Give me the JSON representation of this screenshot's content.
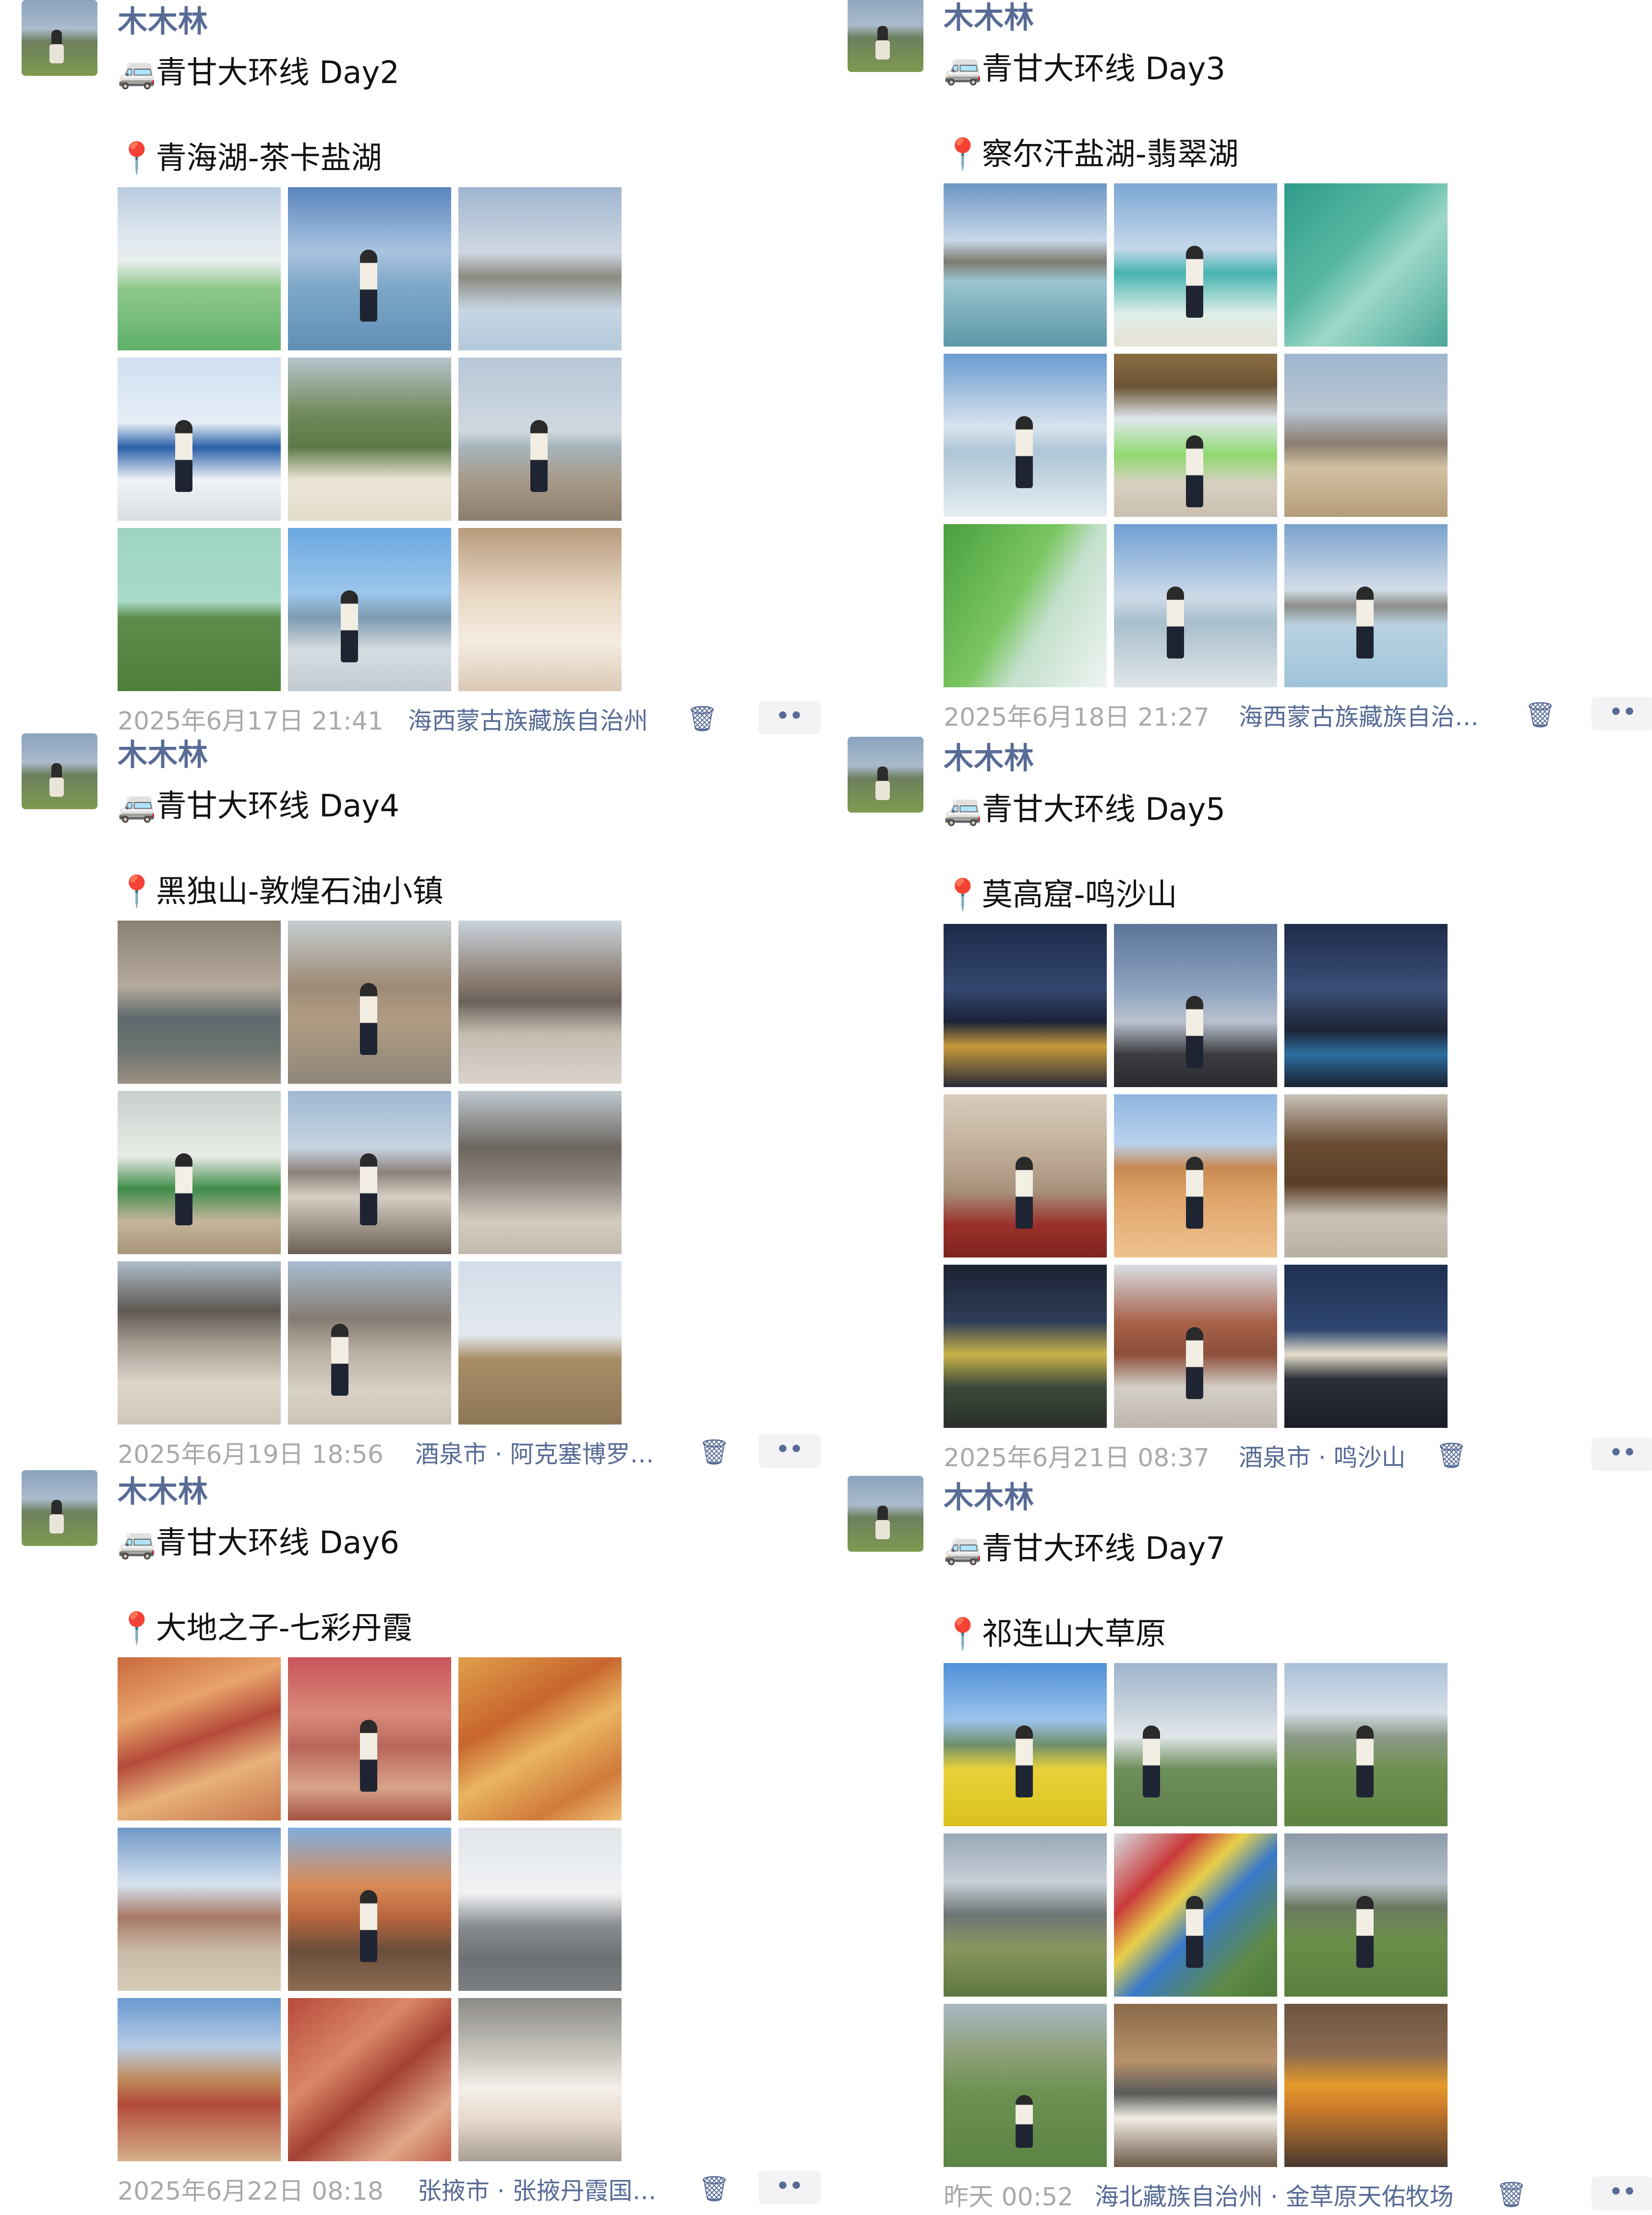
{
  "colors": {
    "link": "#576b95",
    "timestamp": "#a9a9a9",
    "more_button_bg": "#f3f3f5"
  },
  "icons": {
    "bus": "🚐",
    "pin": "📍",
    "trash": "🗑",
    "more": "••"
  },
  "posts": [
    {
      "author": "木木林",
      "title": "青甘大环线 Day2",
      "location_tag": "青海湖-茶卡盐湖",
      "timestamp": "2025年6月17日 21:41",
      "place": "海西蒙古族藏族自治州",
      "photos": [
        "lake-green",
        "woman-lake",
        "salt-lake-mountains",
        "qinghai-sign",
        "woman-sunglasses",
        "woman-bench",
        "grassland",
        "signpost-woman",
        "selfie-friends"
      ]
    },
    {
      "author": "木木林",
      "title": "青甘大环线 Day3",
      "location_tag": "察尔汗盐湖-翡翠湖",
      "timestamp": "2025年6月18日 21:27",
      "place": "海西蒙古族藏族自治…",
      "photos": [
        "lake-reflection",
        "woman-shore",
        "emerald-water",
        "woman-reflection",
        "umbrella-green",
        "mountain-sign",
        "green-salt",
        "woman-signpost",
        "woman-mirror-lake"
      ]
    },
    {
      "author": "木木林",
      "title": "青甘大环线 Day4",
      "location_tag": "黑独山-敦煌石油小镇",
      "timestamp": "2025年6月19日 18:56",
      "place": "酒泉市 · 阿克塞博罗…",
      "photos": [
        "jeep-ruins",
        "woman-buildings",
        "black-mountain",
        "bus-woman",
        "woman-boardwalk",
        "grey-dunes",
        "desert-people",
        "woman-jump",
        "wooden-sign"
      ]
    },
    {
      "author": "木木林",
      "title": "青甘大环线 Day5",
      "location_tag": "莫高窟-鸣沙山",
      "timestamp": "2025年6月21日 08:37",
      "place": "酒泉市 · 鸣沙山",
      "photos": [
        "night-city",
        "dusk-dune",
        "night-sky",
        "mural-woman",
        "sand-dune",
        "temple-gate",
        "night-show",
        "pagoda",
        "night-lights"
      ]
    },
    {
      "author": "木木林",
      "title": "青甘大环线 Day6",
      "location_tag": "大地之子-七彩丹霞",
      "timestamp": "2025年6月22日 08:18",
      "place": "张掖市 · 张掖丹霞国…",
      "photos": [
        "danxia-hills",
        "woman-danxia",
        "orange-ridges",
        "baby-sculpture",
        "woman-railing",
        "road-sign",
        "camel-sculptures",
        "red-rocks",
        "ticket-hand"
      ]
    },
    {
      "author": "木木林",
      "title": "青甘大环线 Day7",
      "location_tag": "祁连山大草原",
      "timestamp": "昨天 00:52",
      "place": "海北藏族自治州 · 金草原天佑牧场",
      "photos": [
        "rapeseed-field",
        "prayer-flags-tent",
        "woman-meadow",
        "snow-mountain",
        "prayer-flags",
        "woman-lamb",
        "woman-sitting",
        "herder-lamb",
        "tea-kettle"
      ]
    }
  ]
}
